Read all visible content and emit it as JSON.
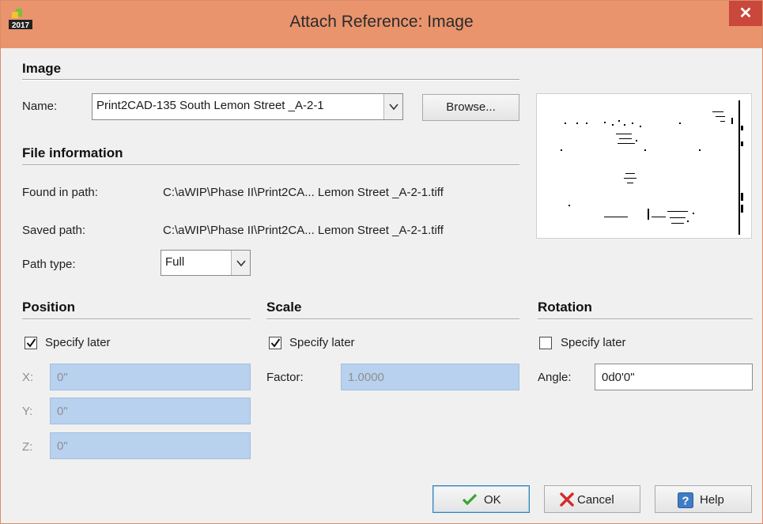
{
  "window": {
    "title": "Attach Reference: Image",
    "app_badge": "2017",
    "close_glyph": "✕"
  },
  "image_section": {
    "title": "Image",
    "name_label": "Name:",
    "name_value": "Print2CAD-135 South Lemon Street _A-2-1",
    "browse_label": "Browse..."
  },
  "file_info": {
    "title": "File information",
    "found_label": "Found in path:",
    "found_value": "C:\\aWIP\\Phase II\\Print2CA... Lemon Street _A-2-1.tiff",
    "saved_label": "Saved path:",
    "saved_value": "C:\\aWIP\\Phase II\\Print2CA... Lemon Street _A-2-1.tiff",
    "path_type_label": "Path type:",
    "path_type_value": "Full"
  },
  "position": {
    "title": "Position",
    "specify_later_label": "Specify later",
    "specify_later_checked": true,
    "x_label": "X:",
    "x_value": "0\"",
    "y_label": "Y:",
    "y_value": "0\"",
    "z_label": "Z:",
    "z_value": "0\""
  },
  "scale": {
    "title": "Scale",
    "specify_later_label": "Specify later",
    "specify_later_checked": true,
    "factor_label": "Factor:",
    "factor_value": "1.0000"
  },
  "rotation": {
    "title": "Rotation",
    "specify_later_label": "Specify later",
    "specify_later_checked": false,
    "angle_label": "Angle:",
    "angle_value": "0d0'0\""
  },
  "buttons": {
    "ok": "OK",
    "cancel": "Cancel",
    "help": "Help"
  },
  "colors": {
    "titlebar": "#e9946d",
    "close": "#c9473b",
    "disabled_field": "#b7d1ee",
    "ok_check": "#3aa52f",
    "cancel_x": "#d42a2a",
    "help_icon": "#3f7cc4"
  },
  "icons": [
    "app-logo-icon",
    "close-icon",
    "dropdown-arrow-icon",
    "checkmark-icon",
    "ok-check-icon",
    "cancel-x-icon",
    "help-icon"
  ]
}
